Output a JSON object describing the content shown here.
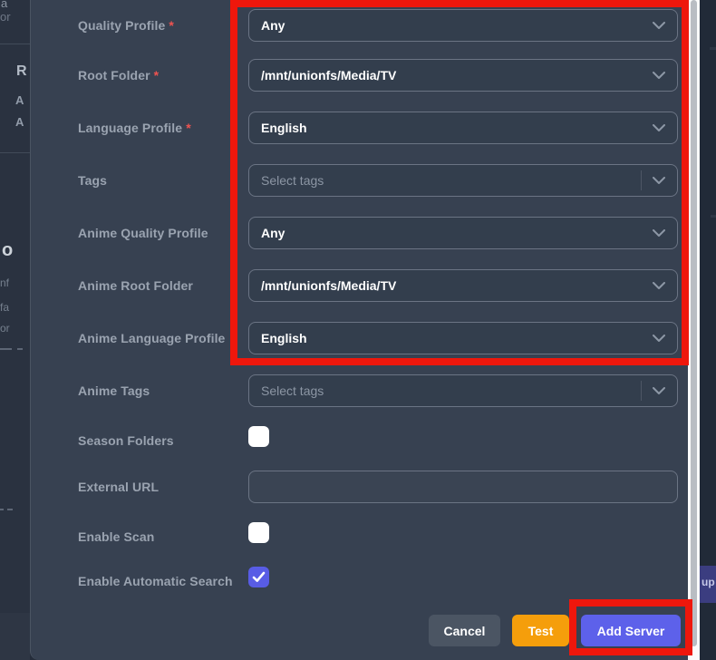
{
  "form": {
    "required_marker": "*",
    "rows": [
      {
        "label": "Quality Profile",
        "required": true,
        "type": "select",
        "value": "Any"
      },
      {
        "label": "Root Folder",
        "required": true,
        "type": "select",
        "value": "/mnt/unionfs/Media/TV"
      },
      {
        "label": "Language Profile",
        "required": true,
        "type": "select",
        "value": "English"
      },
      {
        "label": "Tags",
        "required": false,
        "type": "multiselect",
        "placeholder": "Select tags"
      },
      {
        "label": "Anime Quality Profile",
        "required": false,
        "type": "select",
        "value": "Any"
      },
      {
        "label": "Anime Root Folder",
        "required": false,
        "type": "select",
        "value": "/mnt/unionfs/Media/TV"
      },
      {
        "label": "Anime Language Profile",
        "required": false,
        "type": "select",
        "value": "English"
      },
      {
        "label": "Anime Tags",
        "required": false,
        "type": "multiselect",
        "placeholder": "Select tags"
      },
      {
        "label": "Season Folders",
        "required": false,
        "type": "checkbox",
        "checked": false
      },
      {
        "label": "External URL",
        "required": false,
        "type": "text",
        "value": ""
      },
      {
        "label": "Enable Scan",
        "required": false,
        "type": "checkbox",
        "checked": false
      },
      {
        "label": "Enable Automatic Search",
        "required": false,
        "type": "checkbox",
        "checked": true
      }
    ]
  },
  "footer": {
    "cancel_label": "Cancel",
    "test_label": "Test",
    "add_server_label": "Add Server"
  },
  "background_fragments": {
    "left": [
      "a",
      "or",
      "R",
      "A",
      "A",
      "o",
      "nf",
      "fa",
      "or"
    ],
    "right": "up"
  },
  "annotations": {
    "color": "#ee170c",
    "boxes": [
      "top-form-group",
      "add-server-button"
    ]
  },
  "colors": {
    "modal_bg": "#374151",
    "field_bg": "#333e4d",
    "field_border": "#6b7484",
    "label_text": "#9aa3b0",
    "required_red": "#ef5350",
    "checkbox_checked": "#585ce5",
    "button_cancel": "#4b5563",
    "button_test": "#f59e0b",
    "button_add": "#5d61ea"
  }
}
